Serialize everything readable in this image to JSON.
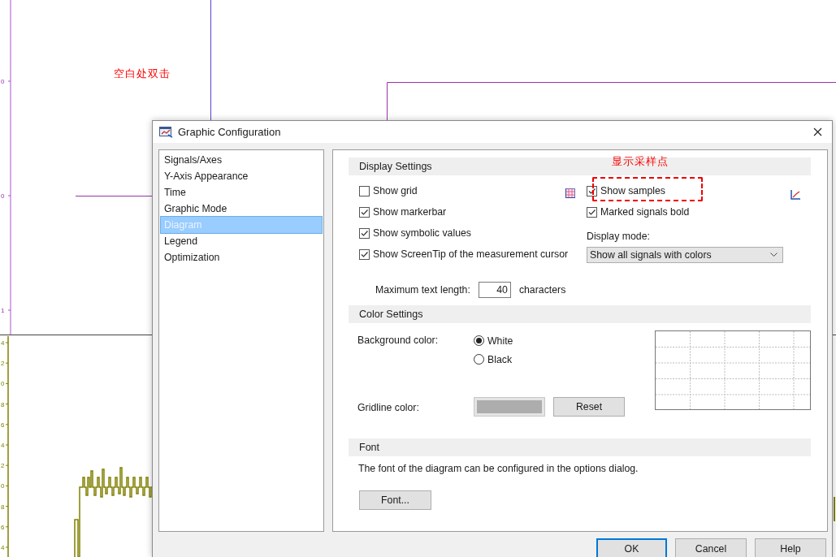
{
  "plot": {
    "upper_ticks": [
      "0",
      "0",
      "1"
    ],
    "lower_ticks": [
      "4",
      "2",
      "0",
      "8",
      "6",
      "4",
      "2",
      "0",
      "8",
      "6",
      "4"
    ]
  },
  "annotations": [
    {
      "kind": "text",
      "text": "空白处双击"
    },
    {
      "kind": "callout",
      "text": "显示采样点"
    }
  ],
  "dialog": {
    "title": "Graphic Configuration",
    "nav": [
      {
        "label": "Signals/Axes",
        "selected": false
      },
      {
        "label": "Y-Axis Appearance",
        "selected": false
      },
      {
        "label": "Time",
        "selected": false
      },
      {
        "label": "Graphic Mode",
        "selected": false
      },
      {
        "label": "Diagram",
        "selected": true
      },
      {
        "label": "Legend",
        "selected": false
      },
      {
        "label": "Optimization",
        "selected": false
      }
    ],
    "display_settings": {
      "heading": "Display Settings",
      "left_options": [
        {
          "label": "Show grid",
          "checked": false
        },
        {
          "label": "Show markerbar",
          "checked": true
        },
        {
          "label": "Show symbolic values",
          "checked": true
        },
        {
          "label": "Show ScreenTip of the measurement cursor",
          "checked": true
        }
      ],
      "right_options": [
        {
          "label": "Show samples",
          "checked": true
        },
        {
          "label": "Marked signals bold",
          "checked": true
        }
      ],
      "display_mode_label": "Display mode:",
      "display_mode": "Show all signals with colors",
      "max_text_label": "Maximum text length:",
      "max_text_value": "40",
      "max_text_unit": "characters"
    },
    "color_settings": {
      "heading": "Color Settings",
      "background_label": "Background color:",
      "background_options": [
        {
          "label": "White",
          "selected": true
        },
        {
          "label": "Black",
          "selected": false
        }
      ],
      "gridline_label": "Gridline color:",
      "reset_button": "Reset"
    },
    "font": {
      "heading": "Font",
      "description": "The font of the diagram can be configured in the options dialog.",
      "button": "Font..."
    },
    "buttons": [
      {
        "label": "OK",
        "default": true
      },
      {
        "label": "Cancel",
        "default": false
      },
      {
        "label": "Help",
        "default": false
      }
    ]
  }
}
